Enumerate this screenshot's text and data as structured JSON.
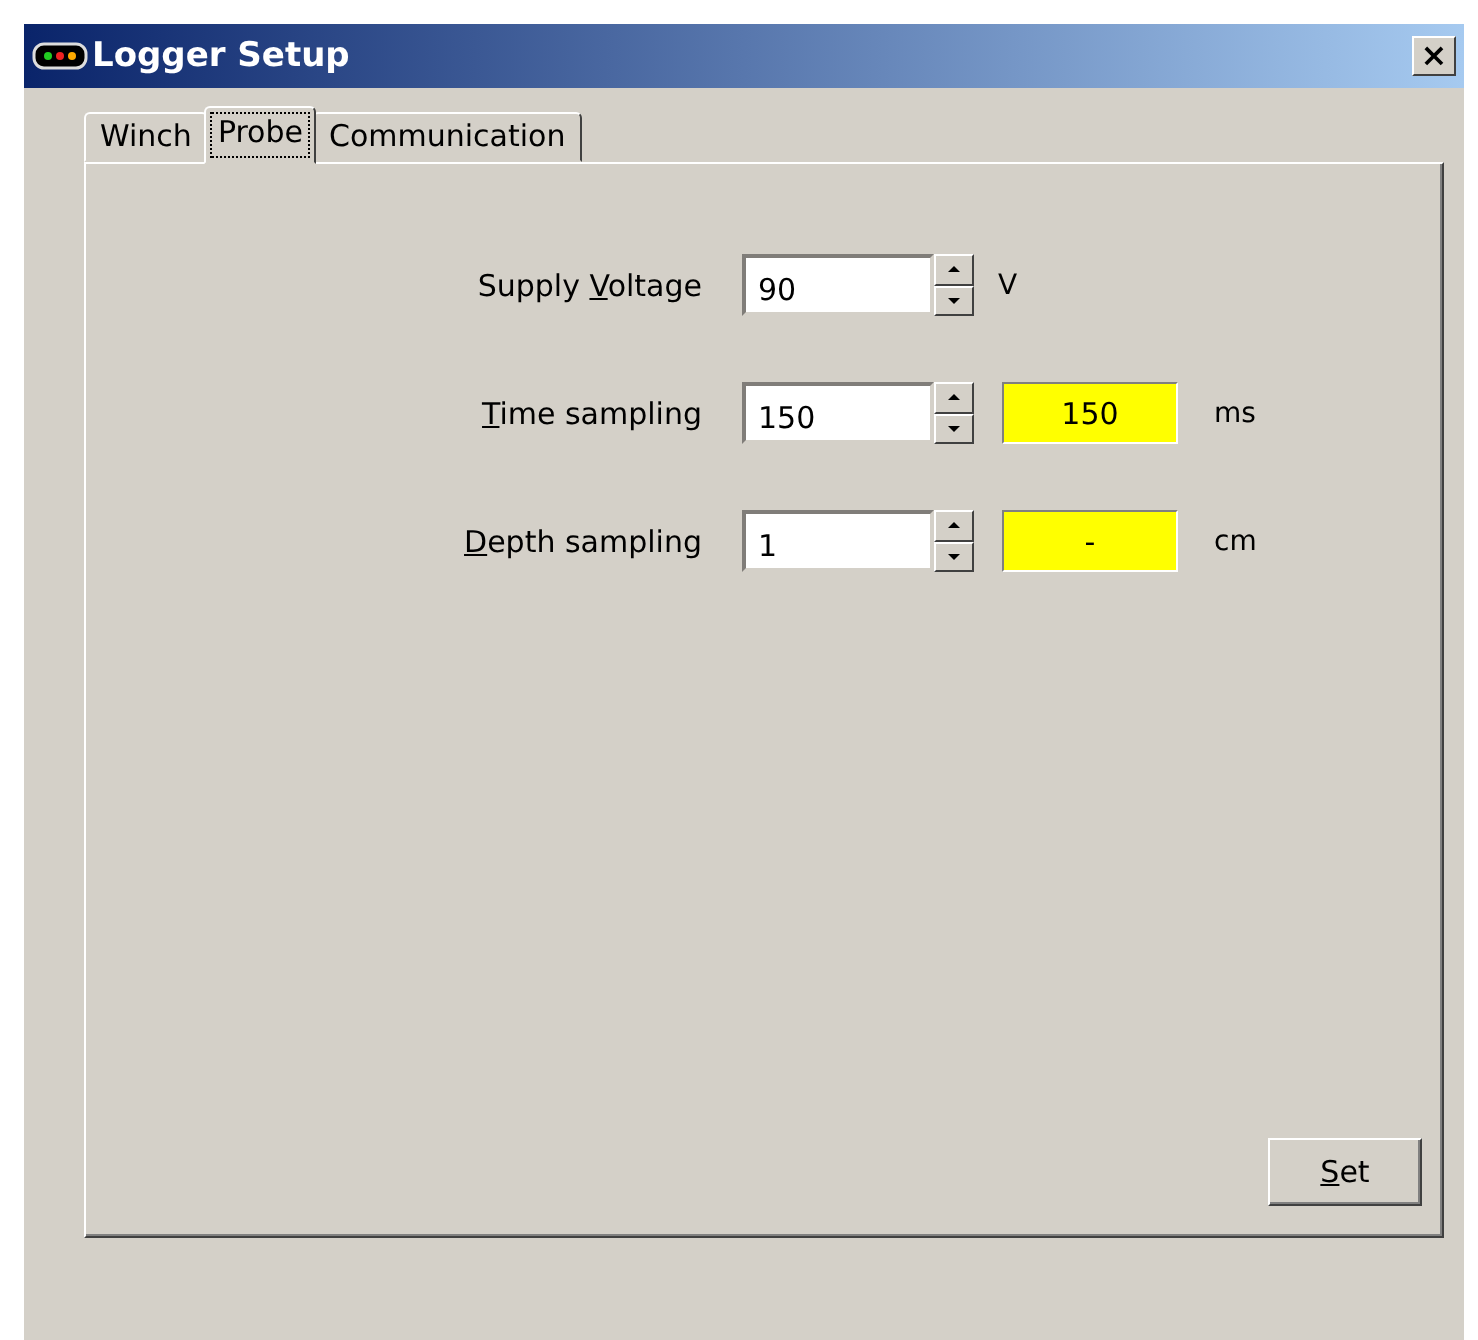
{
  "window": {
    "title": "Logger Setup",
    "close": "×"
  },
  "tabs": [
    {
      "label": "Winch",
      "selected": false
    },
    {
      "label": "Probe",
      "selected": true
    },
    {
      "label": "Communication",
      "selected": false
    }
  ],
  "rows": [
    {
      "label": {
        "before": "Supply ",
        "accel": "V",
        "after": "oltage"
      },
      "value": "90",
      "unit": "V",
      "kind": "plain"
    },
    {
      "label": {
        "accel": "T",
        "after": "ime sampling"
      },
      "value": "150",
      "readout": "150",
      "unit": "ms",
      "kind": "readout"
    },
    {
      "label": {
        "accel": "D",
        "after": "epth sampling"
      },
      "value": "1",
      "readout": "-",
      "unit": "cm",
      "kind": "readout"
    }
  ],
  "set_button": {
    "accel": "S",
    "after": "et"
  }
}
